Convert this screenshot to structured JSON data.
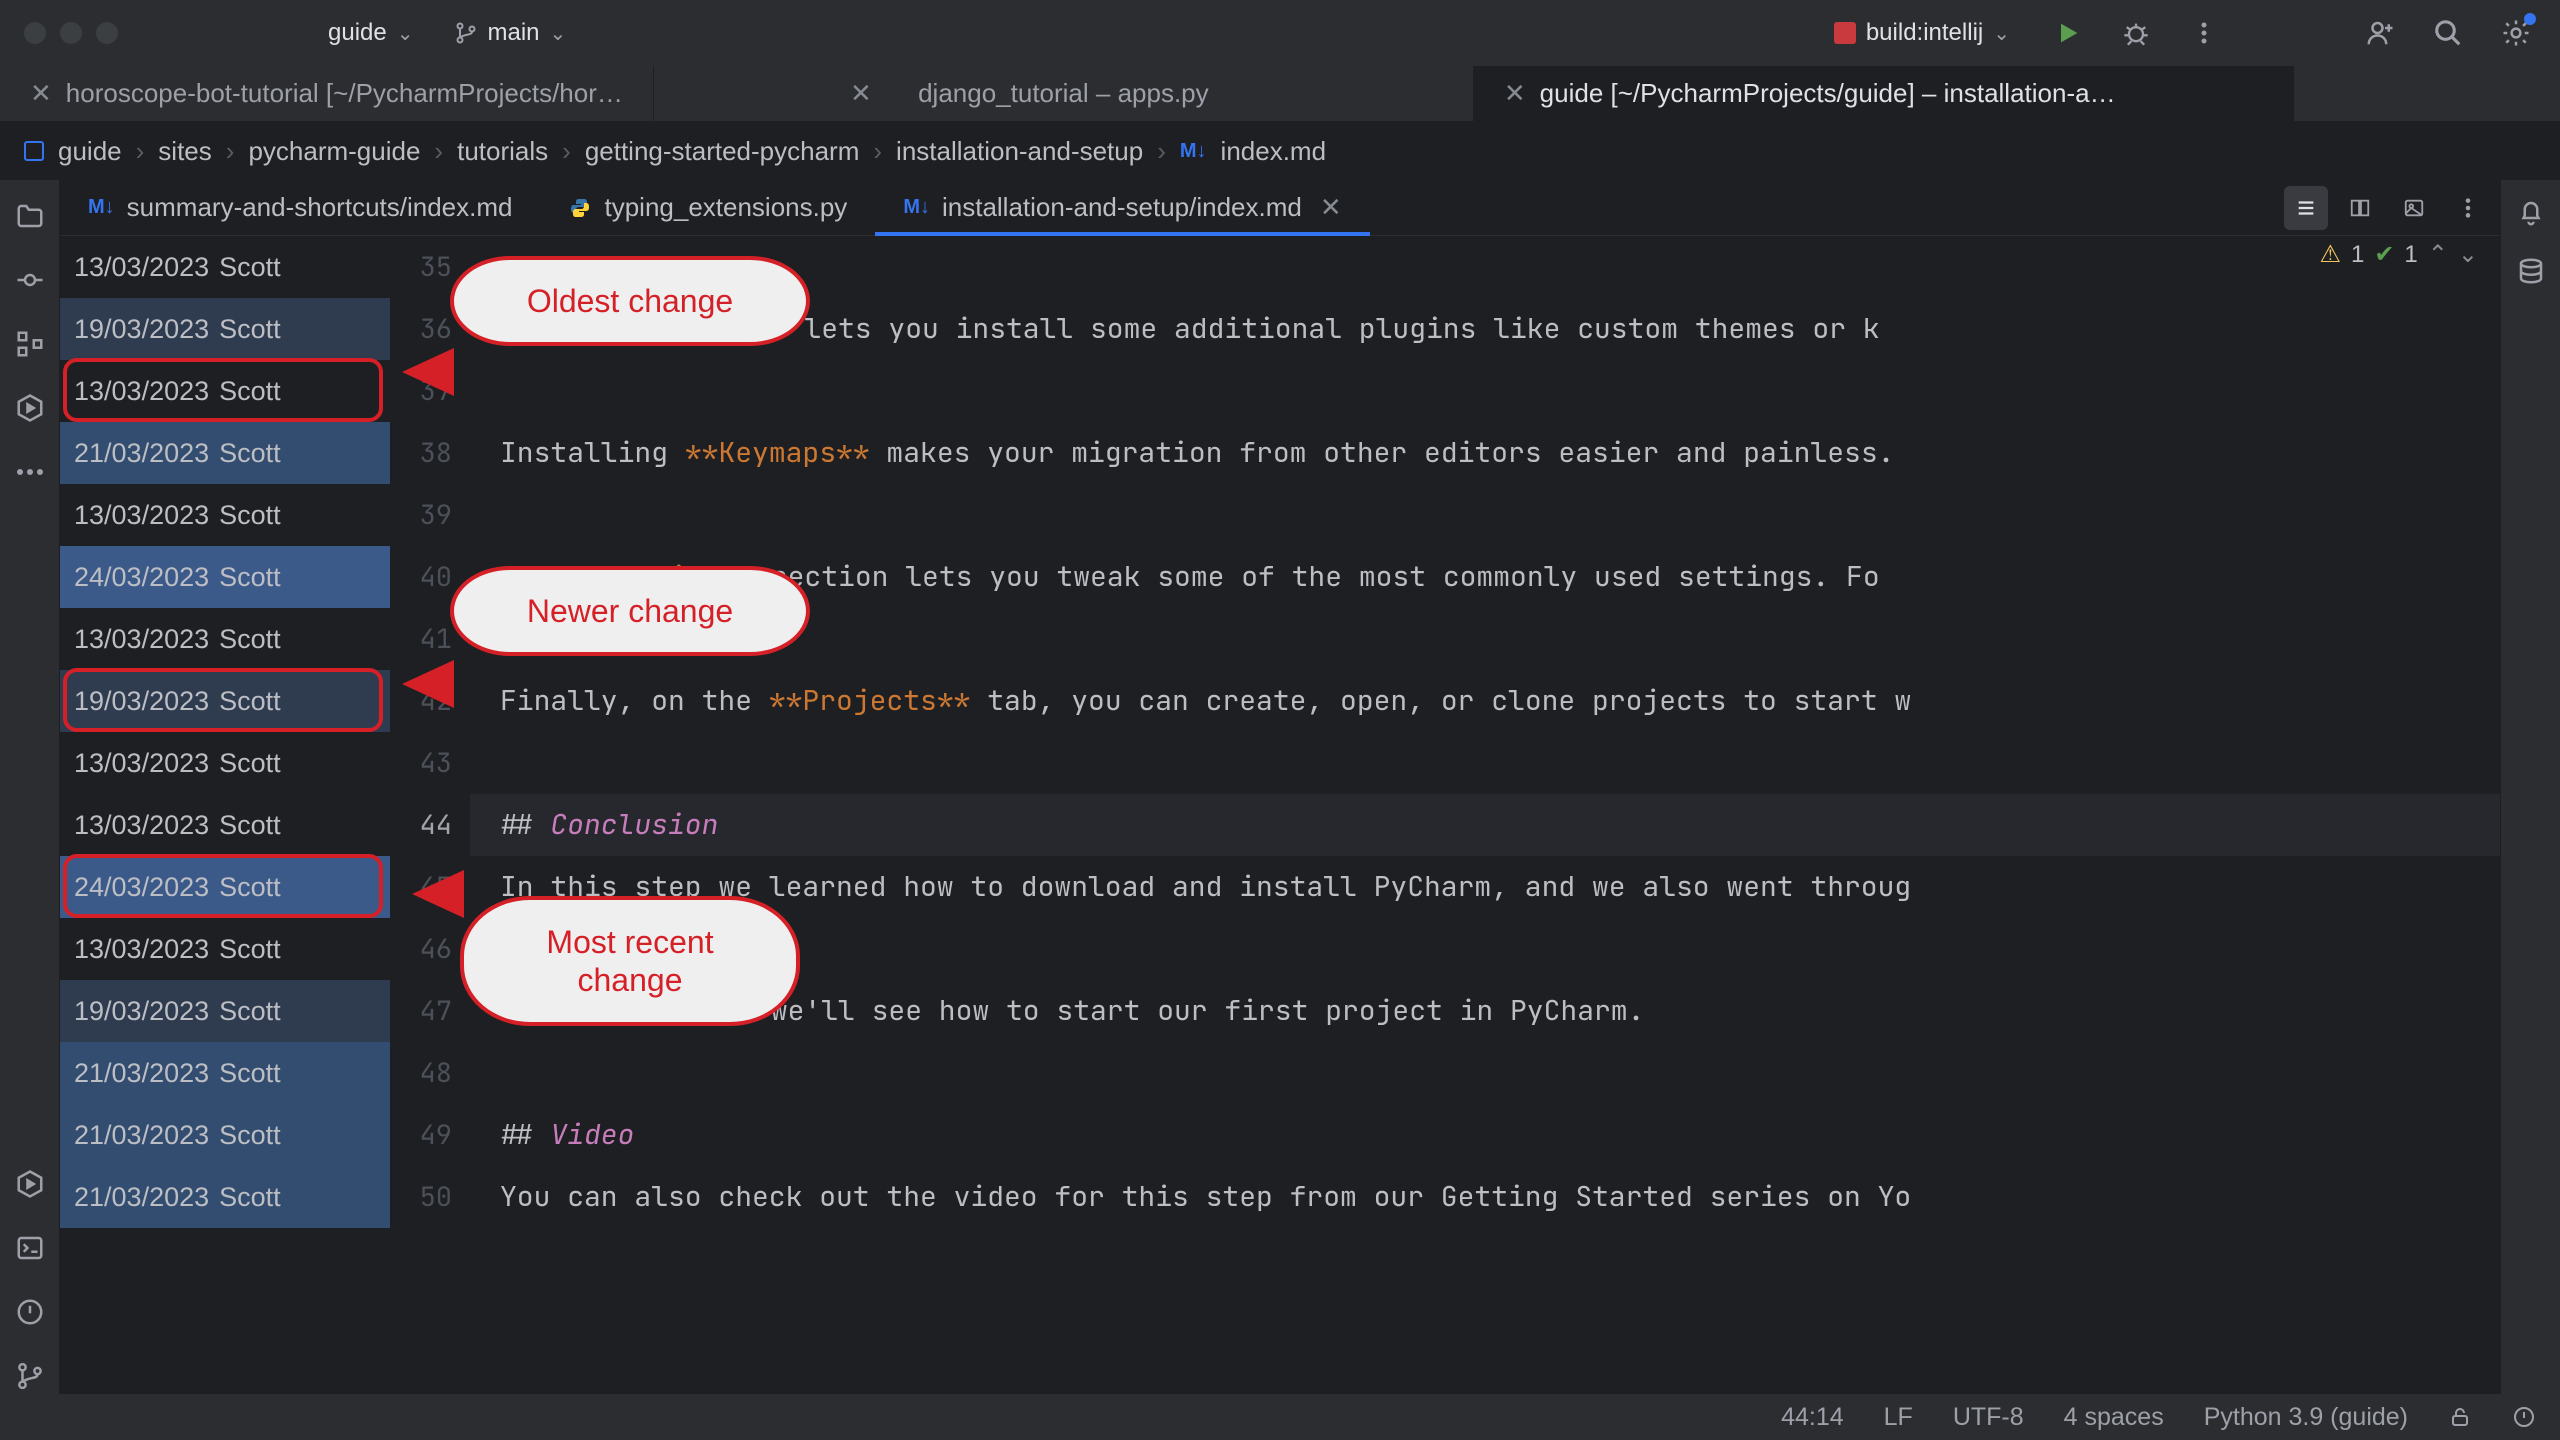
{
  "titlebar": {
    "project": "guide",
    "branch": "main",
    "run_config": "build:intellij"
  },
  "window_tabs": [
    {
      "label": "horoscope-bot-tutorial [~/PycharmProjects/hor…",
      "closable": true,
      "active": false
    },
    {
      "label": "django_tutorial – apps.py",
      "closable": true,
      "active": false
    },
    {
      "label": "guide [~/PycharmProjects/guide] – installation-a…",
      "closable": true,
      "active": true
    }
  ],
  "breadcrumb": {
    "items": [
      "guide",
      "sites",
      "pycharm-guide",
      "tutorials",
      "getting-started-pycharm",
      "installation-and-setup",
      "index.md"
    ]
  },
  "editor_tabs": [
    {
      "label": "summary-and-shortcuts/index.md",
      "icon": "md",
      "active": false,
      "closable": false
    },
    {
      "label": "typing_extensions.py",
      "icon": "py",
      "active": false,
      "closable": false
    },
    {
      "label": "installation-and-setup/index.md",
      "icon": "md",
      "active": true,
      "closable": true
    }
  ],
  "inspections": {
    "warnings": "1",
    "ok": "1"
  },
  "blame": [
    {
      "date": "13/03/2023",
      "author": "Scott",
      "hl": 0
    },
    {
      "date": "19/03/2023",
      "author": "Scott",
      "hl": 1
    },
    {
      "date": "13/03/2023",
      "author": "Scott",
      "hl": 0
    },
    {
      "date": "21/03/2023",
      "author": "Scott",
      "hl": 2
    },
    {
      "date": "13/03/2023",
      "author": "Scott",
      "hl": 0
    },
    {
      "date": "24/03/2023",
      "author": "Scott",
      "hl": 3
    },
    {
      "date": "13/03/2023",
      "author": "Scott",
      "hl": 0
    },
    {
      "date": "19/03/2023",
      "author": "Scott",
      "hl": 1
    },
    {
      "date": "13/03/2023",
      "author": "Scott",
      "hl": 0
    },
    {
      "date": "13/03/2023",
      "author": "Scott",
      "hl": 0
    },
    {
      "date": "24/03/2023",
      "author": "Scott",
      "hl": 3
    },
    {
      "date": "13/03/2023",
      "author": "Scott",
      "hl": 0
    },
    {
      "date": "19/03/2023",
      "author": "Scott",
      "hl": 1
    },
    {
      "date": "21/03/2023",
      "author": "Scott",
      "hl": 2
    },
    {
      "date": "21/03/2023",
      "author": "Scott",
      "hl": 2
    },
    {
      "date": "21/03/2023",
      "author": "Scott",
      "hl": 2
    }
  ],
  "gutter_start": 35,
  "current_line": 44,
  "code_lines": [
    {
      "segments": []
    },
    {
      "segments": [
        {
          "t": "s** tab lets you install some additional plugins like custom themes or k"
        }
      ],
      "prefix": "",
      "frag_left": true
    },
    {
      "segments": []
    },
    {
      "segments": [
        {
          "t": "Installing "
        },
        {
          "t": "**Keymaps**",
          "c": "tok-bold"
        },
        {
          "t": " makes your migration from other editors easier and painless."
        }
      ]
    },
    {
      "segments": []
    },
    {
      "segments": [
        {
          "t": "ize**",
          "c": "tok-bold"
        },
        {
          "t": " section lets you tweak some of the most commonly used settings. Fo"
        }
      ],
      "frag_left": true
    },
    {
      "segments": []
    },
    {
      "segments": [
        {
          "t": "Finally, on the "
        },
        {
          "t": "**Projects**",
          "c": "tok-bold"
        },
        {
          "t": " tab, you can create, open, or clone projects to start w"
        }
      ]
    },
    {
      "segments": []
    },
    {
      "segments": [
        {
          "t": "## ",
          "c": "tok-hash"
        },
        {
          "t": "Conclusion",
          "c": "tok-head"
        }
      ]
    },
    {
      "segments": [
        {
          "t": "In this step we learned how to download and install PyCharm, and we also went throug"
        }
      ]
    },
    {
      "segments": []
    },
    {
      "segments": [
        {
          "t": "step, we'll see how to start our first project in PyCharm."
        }
      ],
      "frag_left": true
    },
    {
      "segments": []
    },
    {
      "segments": [
        {
          "t": "## ",
          "c": "tok-hash"
        },
        {
          "t": "Video",
          "c": "tok-head"
        }
      ]
    },
    {
      "segments": [
        {
          "t": "You can also check out the video for this step from our Getting Started series on Yo"
        }
      ]
    }
  ],
  "annotations": {
    "oldest": "Oldest change",
    "newer": "Newer change",
    "recent": "Most recent change"
  },
  "statusbar": {
    "caret": "44:14",
    "line_ending": "LF",
    "encoding": "UTF-8",
    "indent": "4 spaces",
    "interpreter": "Python 3.9 (guide)"
  }
}
